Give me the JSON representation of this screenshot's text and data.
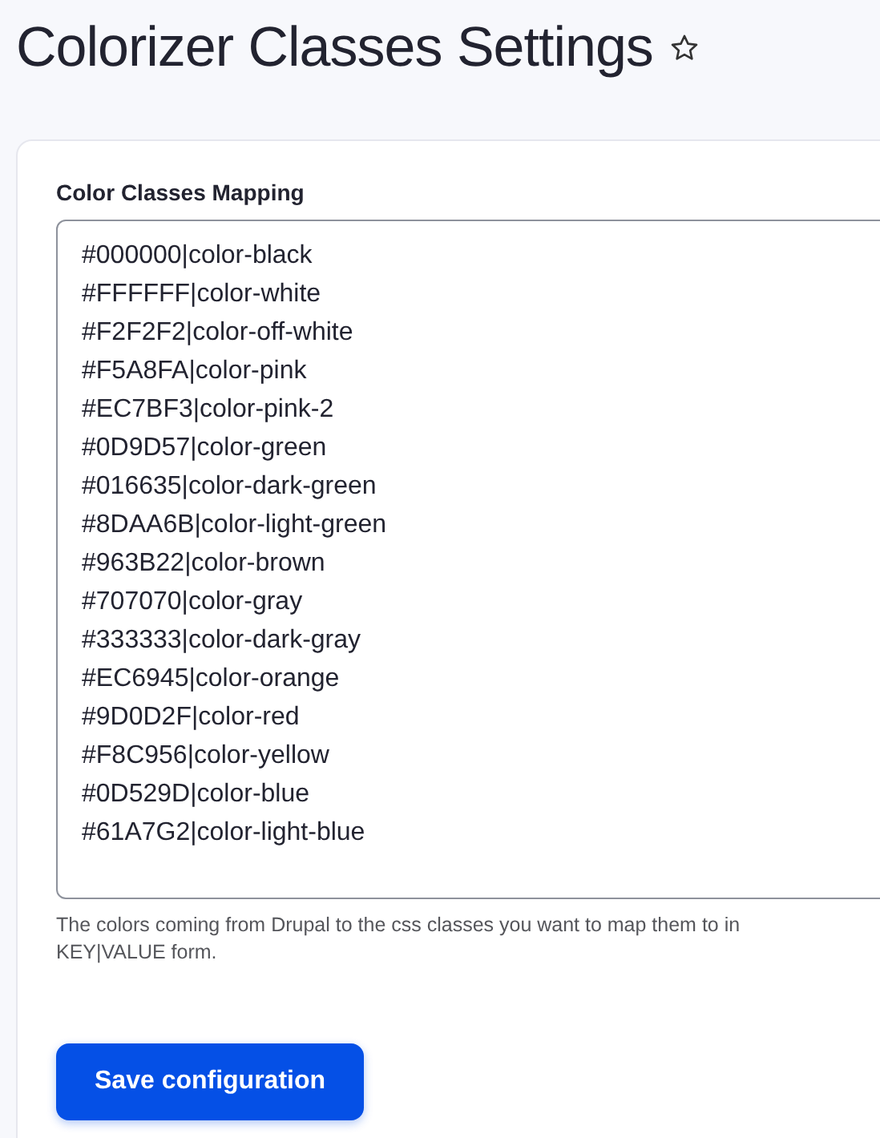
{
  "page": {
    "title": "Colorizer Classes Settings",
    "favorite": false
  },
  "form": {
    "label": "Color Classes Mapping",
    "mapping_lines": [
      "#000000|color-black",
      "#FFFFFF|color-white",
      "#F2F2F2|color-off-white",
      "#F5A8FA|color-pink",
      "#EC7BF3|color-pink-2",
      "#0D9D57|color-green",
      "#016635|color-dark-green",
      "#8DAA6B|color-light-green",
      "#963B22|color-brown",
      "#707070|color-gray",
      "#333333|color-dark-gray",
      "#EC6945|color-orange",
      "#9D0D2F|color-red",
      "#F8C956|color-yellow",
      "#0D529D|color-blue",
      "#61A7G2|color-light-blue"
    ],
    "description": "The colors coming from Drupal to the css classes you want to map them to in KEY|VALUE form.",
    "submit": "Save configuration"
  }
}
